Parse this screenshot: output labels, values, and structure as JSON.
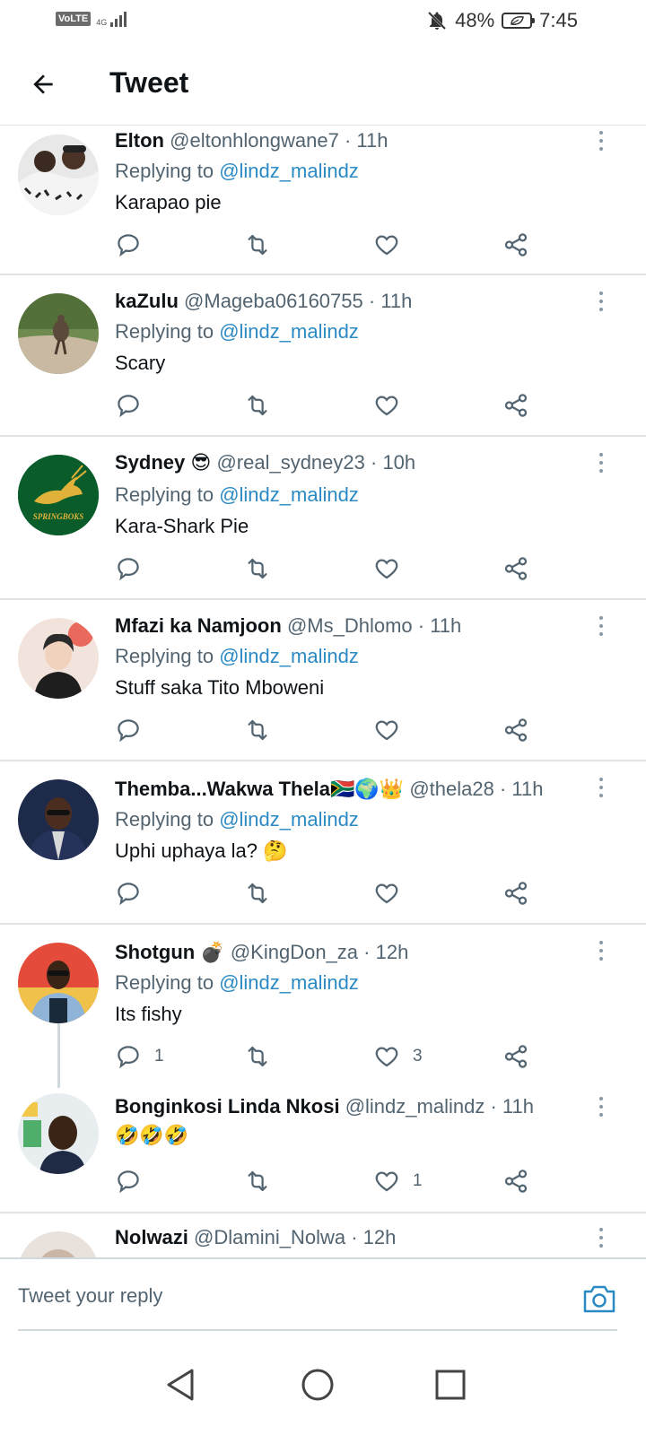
{
  "status_bar": {
    "volte": "VoLTE",
    "network": "4G",
    "battery": "48%",
    "time": "7:45"
  },
  "header": {
    "title": "Tweet"
  },
  "tweets": [
    {
      "name": "Elton",
      "handle": "@eltonhlongwane7",
      "time": "· 11h",
      "replying_prefix": "Replying to ",
      "mention": "@lindz_malindz",
      "text": "Karapao pie",
      "reply_count": "",
      "like_count": ""
    },
    {
      "name": "kaZulu",
      "handle": "@Mageba06160755",
      "time": "· 11h",
      "replying_prefix": "Replying to ",
      "mention": "@lindz_malindz",
      "text": "Scary",
      "reply_count": "",
      "like_count": ""
    },
    {
      "name": "Sydney 😎",
      "handle": "@real_sydney23",
      "time": "· 10h",
      "replying_prefix": "Replying to ",
      "mention": "@lindz_malindz",
      "text": "Kara-Shark Pie",
      "avatar_text": "SPRINGBOKS",
      "reply_count": "",
      "like_count": ""
    },
    {
      "name": "Mfazi ka Namjoon",
      "handle": "@Ms_Dhlomo",
      "time": "· 11h",
      "replying_prefix": "Replying to ",
      "mention": "@lindz_malindz",
      "text": "Stuff saka Tito Mboweni",
      "reply_count": "",
      "like_count": ""
    },
    {
      "name": "Themba...Wakwa Thela🇿🇦🌍👑",
      "handle": "@thela28",
      "time": "· 11h",
      "replying_prefix": "Replying to ",
      "mention": "@lindz_malindz",
      "text": "Uphi uphaya la? 🤔",
      "reply_count": "",
      "like_count": ""
    },
    {
      "name": "Shotgun 💣",
      "handle": "@KingDon_za",
      "time": "· 12h",
      "replying_prefix": "Replying to ",
      "mention": "@lindz_malindz",
      "text": "Its fishy",
      "reply_count": "1",
      "like_count": "3"
    },
    {
      "name": "Bonginkosi Linda Nkosi",
      "handle": "@lindz_malindz",
      "time": "· 11h",
      "text": "🤣🤣🤣",
      "reply_count": "",
      "like_count": "1"
    },
    {
      "name": "Nolwazi",
      "handle": "@Dlamini_Nolwa",
      "time": "· 12h"
    }
  ],
  "reply_bar": {
    "placeholder": "Tweet your reply"
  },
  "icons": {
    "back": "arrow-left-icon",
    "reply": "speech-bubble-icon",
    "retweet": "retweet-icon",
    "like": "heart-icon",
    "share": "share-icon",
    "more": "vertical-dots-icon",
    "camera": "camera-icon",
    "nav_back": "triangle-back-icon",
    "nav_home": "circle-home-icon",
    "nav_recent": "square-recent-icon"
  },
  "colors": {
    "link": "#2b8ac4",
    "text": "#0f1419",
    "secondary": "#536471",
    "divider": "#dfe3e6",
    "springboks_green": "#0a5c2b",
    "springboks_gold": "#e0b23a"
  }
}
